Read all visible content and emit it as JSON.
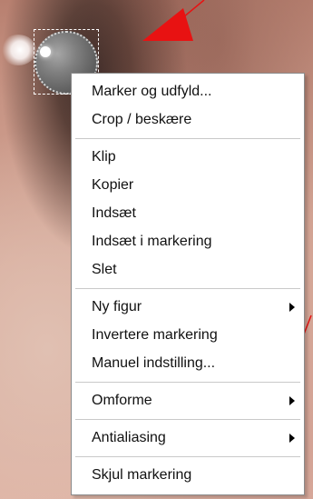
{
  "colors": {
    "menu_background": "#ffffff",
    "menu_text": "#111111",
    "annotation_red": "#e81212",
    "selection_border": "#ffffff"
  },
  "menu": {
    "groups": [
      [
        {
          "label": "Marker og udfyld...",
          "has_submenu": false
        },
        {
          "label": "Crop / beskære",
          "has_submenu": false
        }
      ],
      [
        {
          "label": "Klip",
          "has_submenu": false
        },
        {
          "label": "Kopier",
          "has_submenu": false
        },
        {
          "label": "Indsæt",
          "has_submenu": false
        },
        {
          "label": "Indsæt i markering",
          "has_submenu": false
        },
        {
          "label": "Slet",
          "has_submenu": false
        }
      ],
      [
        {
          "label": "Ny figur",
          "has_submenu": true
        },
        {
          "label": "Invertere markering",
          "has_submenu": false
        },
        {
          "label": "Manuel indstilling...",
          "has_submenu": false
        }
      ],
      [
        {
          "label": "Omforme",
          "has_submenu": true
        }
      ],
      [
        {
          "label": "Antialiasing",
          "has_submenu": true
        }
      ],
      [
        {
          "label": "Skjul markering",
          "has_submenu": false
        }
      ]
    ]
  },
  "icons": {
    "submenu": "chevron-right-icon",
    "annotation": "red-arrow-icon"
  }
}
